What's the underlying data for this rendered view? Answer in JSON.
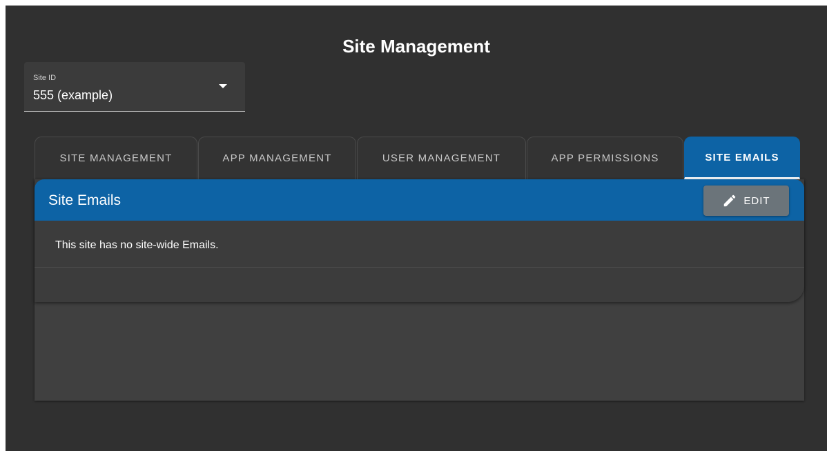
{
  "page": {
    "title": "Site Management"
  },
  "site_select": {
    "label": "Site ID",
    "value": "555 (example)"
  },
  "tabs": [
    {
      "label": "SITE MANAGEMENT",
      "active": false
    },
    {
      "label": "APP MANAGEMENT",
      "active": false
    },
    {
      "label": "USER MANAGEMENT",
      "active": false
    },
    {
      "label": "APP PERMISSIONS",
      "active": false
    },
    {
      "label": "SITE EMAILS",
      "active": true
    }
  ],
  "card": {
    "title": "Site Emails",
    "edit_label": "EDIT",
    "edit_icon": "pencil-icon",
    "empty_message": "This site has no site-wide Emails."
  },
  "colors": {
    "background": "#303030",
    "accent": "#0d63a5",
    "edit_button": "#6b747a"
  }
}
